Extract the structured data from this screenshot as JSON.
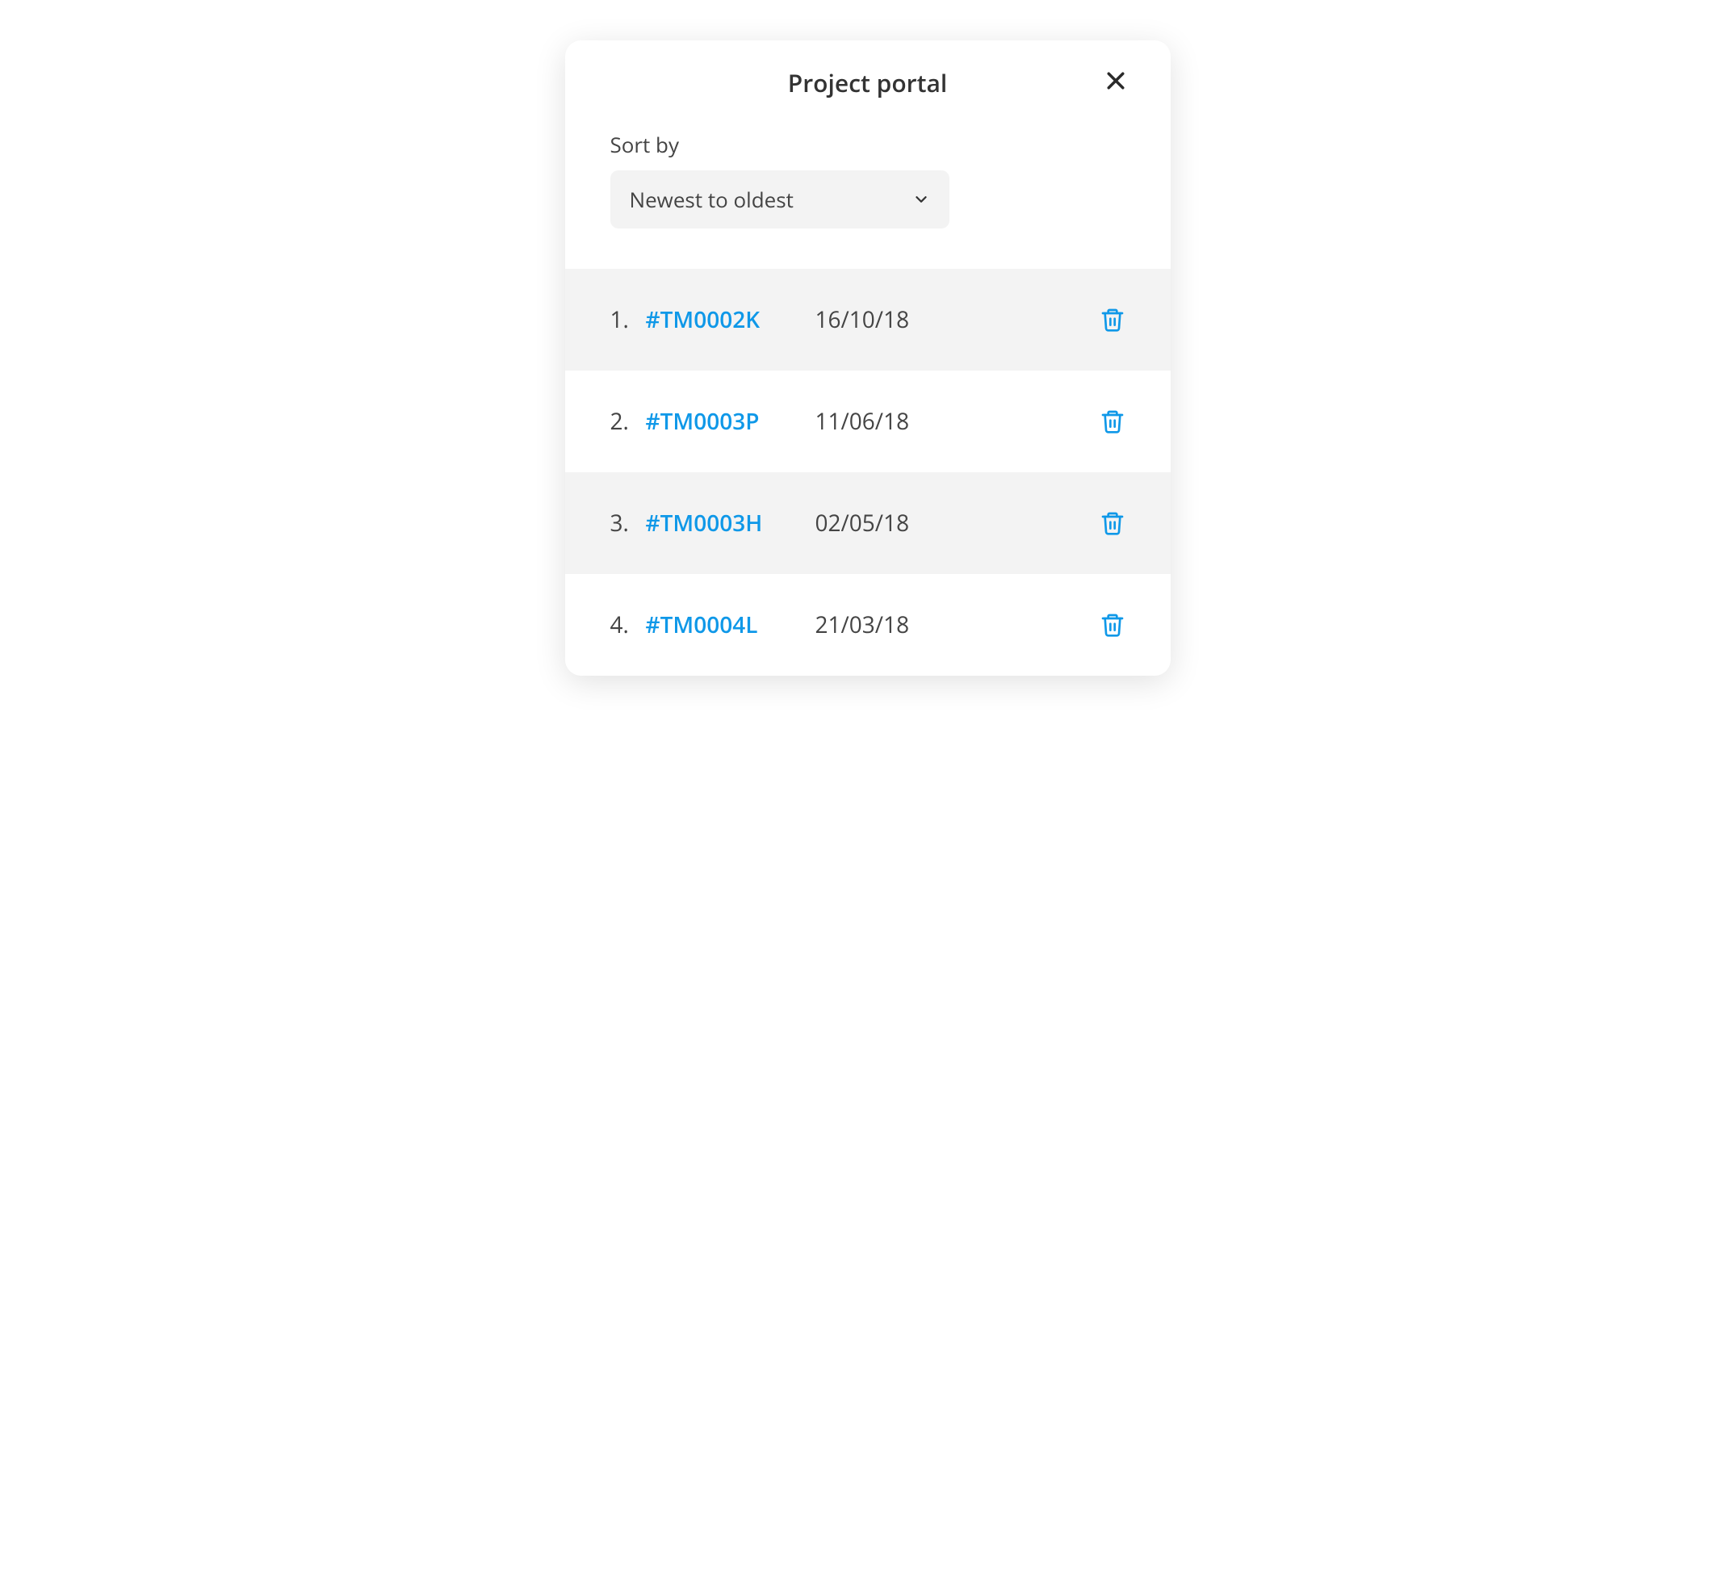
{
  "modal": {
    "title": "Project portal",
    "sort": {
      "label": "Sort by",
      "selected": "Newest to oldest"
    },
    "items": [
      {
        "index": "1.",
        "code": "#TM0002K",
        "date": "16/10/18"
      },
      {
        "index": "2.",
        "code": "#TM0003P",
        "date": "11/06/18"
      },
      {
        "index": "3.",
        "code": "#TM0003H",
        "date": "02/05/18"
      },
      {
        "index": "4.",
        "code": "#TM0004L",
        "date": "21/03/18"
      }
    ]
  },
  "colors": {
    "accent": "#0f98e8",
    "text": "#444444",
    "stripe": "#f3f3f3"
  }
}
